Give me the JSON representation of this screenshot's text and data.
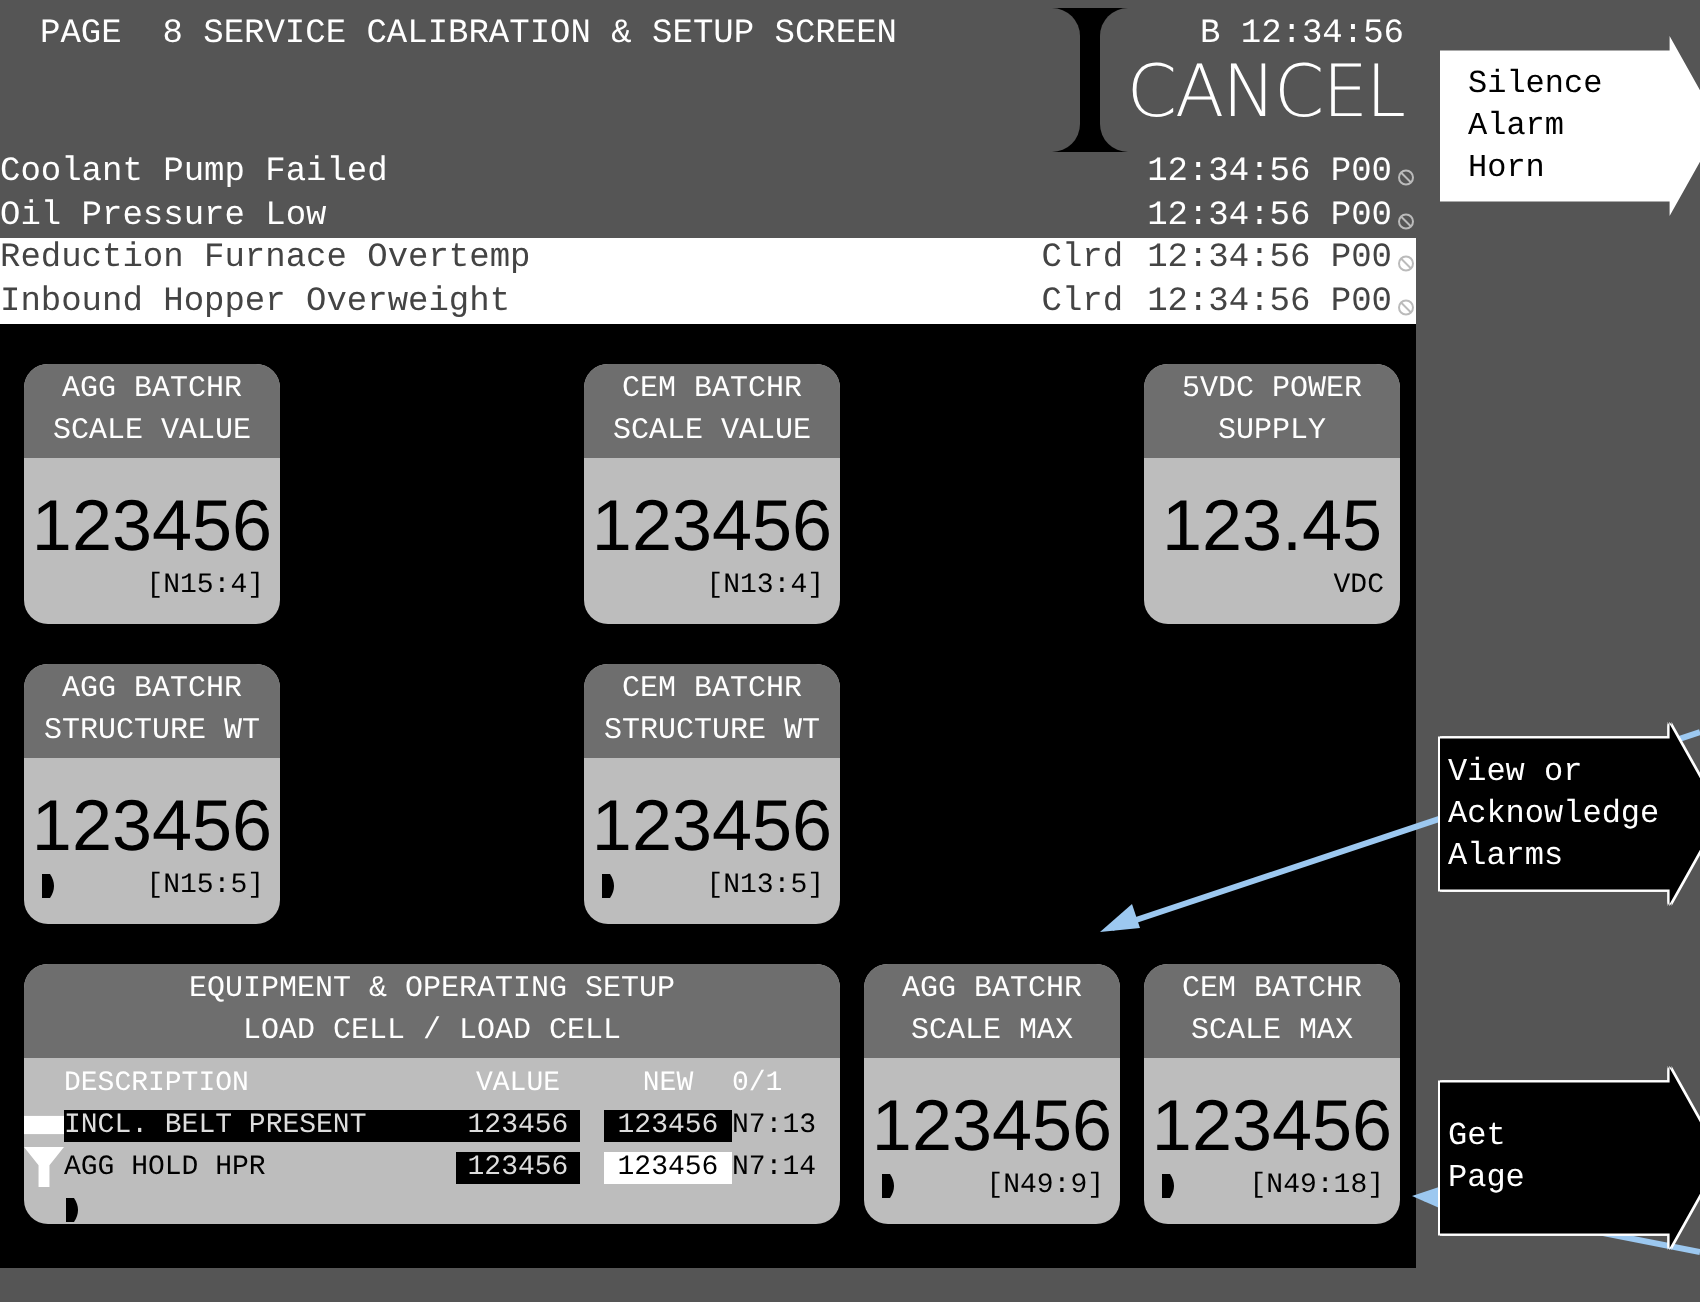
{
  "header": {
    "title": "PAGE  8 SERVICE CALIBRATION & SETUP SCREEN",
    "clock": "B 12:34:56",
    "cancel_button": "CANCEL"
  },
  "alarms": [
    {
      "message": "Coolant Pump Failed",
      "time": "12:34:56 P00",
      "cleared": false
    },
    {
      "message": "Oil Pressure Low",
      "time": "12:34:56 P00",
      "cleared": false
    },
    {
      "message": "Reduction Furnace Overtemp",
      "status": "Clrd",
      "time": "12:34:56 P00",
      "cleared": true
    },
    {
      "message": "Inbound Hopper Overweight",
      "status": "Clrd",
      "time": "12:34:56 P00",
      "cleared": true
    }
  ],
  "tiles": [
    {
      "title": [
        "AGG BATCHR",
        "SCALE VALUE"
      ],
      "value": "123456",
      "tag": "[N15:4]",
      "pointer": false
    },
    {
      "title": [
        "CEM BATCHR",
        "SCALE VALUE"
      ],
      "value": "123456",
      "tag": "[N13:4]",
      "pointer": false
    },
    {
      "title": [
        "5VDC POWER",
        "SUPPLY"
      ],
      "value": "123.45",
      "tag": "VDC",
      "pointer": false
    },
    {
      "title": [
        "AGG BATCHR",
        "STRUCTURE WT"
      ],
      "value": "123456",
      "tag": "[N15:5]",
      "pointer": true
    },
    {
      "title": [
        "CEM BATCHR",
        "STRUCTURE WT"
      ],
      "value": "123456",
      "tag": "[N13:5]",
      "pointer": true
    },
    {
      "title": [
        "AGG BATCHR",
        "SCALE MAX"
      ],
      "value": "123456",
      "tag": "[N49:9]",
      "pointer": true
    },
    {
      "title": [
        "CEM BATCHR",
        "SCALE MAX"
      ],
      "value": "123456",
      "tag": "[N49:18]",
      "pointer": true
    }
  ],
  "setup": {
    "title": [
      "EQUIPMENT & OPERATING SETUP",
      "LOAD CELL / LOAD CELL"
    ],
    "columns": [
      "DESCRIPTION",
      "VALUE",
      "NEW",
      "0/1"
    ],
    "rows": [
      {
        "kind": "block",
        "description": "INCL. BELT PRESENT",
        "value": "123456",
        "new": "123456",
        "address": "N7:13",
        "selected": true,
        "editing": false
      },
      {
        "kind": "funnel",
        "description": "AGG HOLD HPR",
        "value": "123456",
        "new": "123456",
        "address": "N7:14",
        "selected": false,
        "editing": true
      }
    ]
  },
  "side_buttons": [
    {
      "label": [
        "Silence",
        "Alarm",
        "Horn"
      ],
      "kind": "light"
    },
    {
      "label": [
        "View or",
        "Acknowledge",
        "Alarms"
      ],
      "kind": "dark"
    },
    {
      "label": [
        "Get",
        "Page"
      ],
      "kind": "dark"
    }
  ]
}
